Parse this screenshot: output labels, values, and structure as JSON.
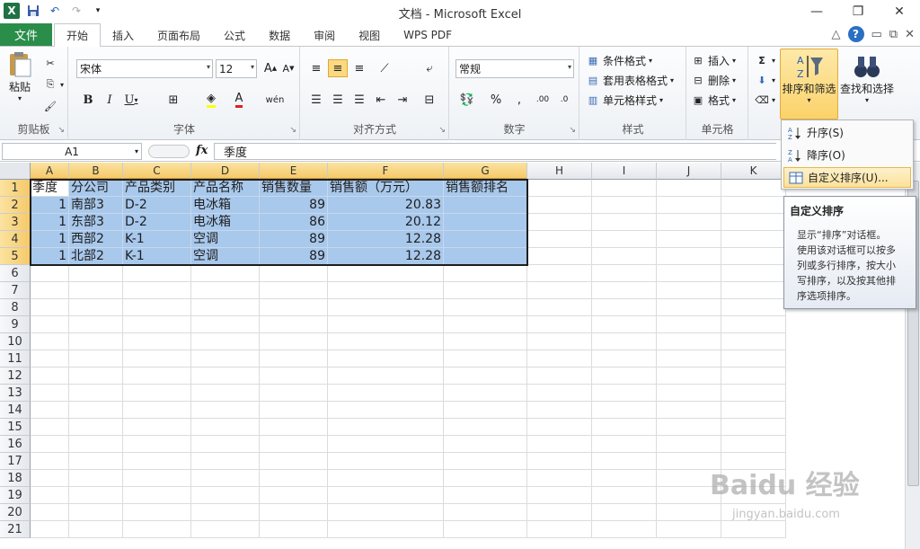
{
  "window": {
    "title": "文档 - Microsoft Excel"
  },
  "tabs": {
    "file": "文件",
    "items": [
      "开始",
      "插入",
      "页面布局",
      "公式",
      "数据",
      "审阅",
      "视图",
      "WPS PDF"
    ]
  },
  "ribbon": {
    "clipboard": {
      "label": "剪贴板",
      "paste": "粘贴"
    },
    "font": {
      "label": "字体",
      "name": "宋体",
      "size": "12"
    },
    "alignment": {
      "label": "对齐方式"
    },
    "number": {
      "label": "数字",
      "format": "常规"
    },
    "styles": {
      "label": "样式",
      "conditional": "条件格式",
      "table": "套用表格格式",
      "cell": "单元格样式"
    },
    "cells": {
      "label": "单元格",
      "insert": "插入",
      "delete": "删除",
      "format": "格式"
    },
    "editing": {
      "sort_filter": "排序和筛选",
      "find_select": "查找和选择"
    }
  },
  "formula_bar": {
    "name_box": "A1",
    "fx": "fx",
    "content": "季度"
  },
  "columns": [
    "A",
    "B",
    "C",
    "D",
    "E",
    "F",
    "G",
    "H",
    "I",
    "J",
    "K"
  ],
  "rows": [
    "1",
    "2",
    "3",
    "4",
    "5",
    "6",
    "7",
    "8",
    "9",
    "10",
    "11",
    "12",
    "13",
    "14",
    "15",
    "16",
    "17",
    "18",
    "19",
    "20",
    "21"
  ],
  "sheet": {
    "header": [
      "季度",
      "分公司",
      "产品类别",
      "产品名称",
      "销售数量",
      "销售额（万元）",
      "销售额排名"
    ],
    "data": [
      [
        "1",
        "南部3",
        "D-2",
        "电冰箱",
        "89",
        "20.83",
        ""
      ],
      [
        "1",
        "东部3",
        "D-2",
        "电冰箱",
        "86",
        "20.12",
        ""
      ],
      [
        "1",
        "西部2",
        "K-1",
        "空调",
        "89",
        "12.28",
        ""
      ],
      [
        "1",
        "北部2",
        "K-1",
        "空调",
        "89",
        "12.28",
        ""
      ]
    ]
  },
  "sort_menu": {
    "ascending": "升序(S)",
    "descending": "降序(O)",
    "custom": "自定义排序(U)..."
  },
  "tooltip": {
    "title": "自定义排序",
    "lines": [
      "显示“排序”对话框。",
      "使用该对话框可以按多",
      "列或多行排序，按大小",
      "写排序，以及按其他排",
      "序选项排序。"
    ]
  },
  "watermark": {
    "text": "Baidu 经验",
    "sub": "jingyan.baidu.com"
  },
  "colors": {
    "accent": "#2a8d4a",
    "selection": "#a8c8ec",
    "highlight": "#fbd26a"
  }
}
